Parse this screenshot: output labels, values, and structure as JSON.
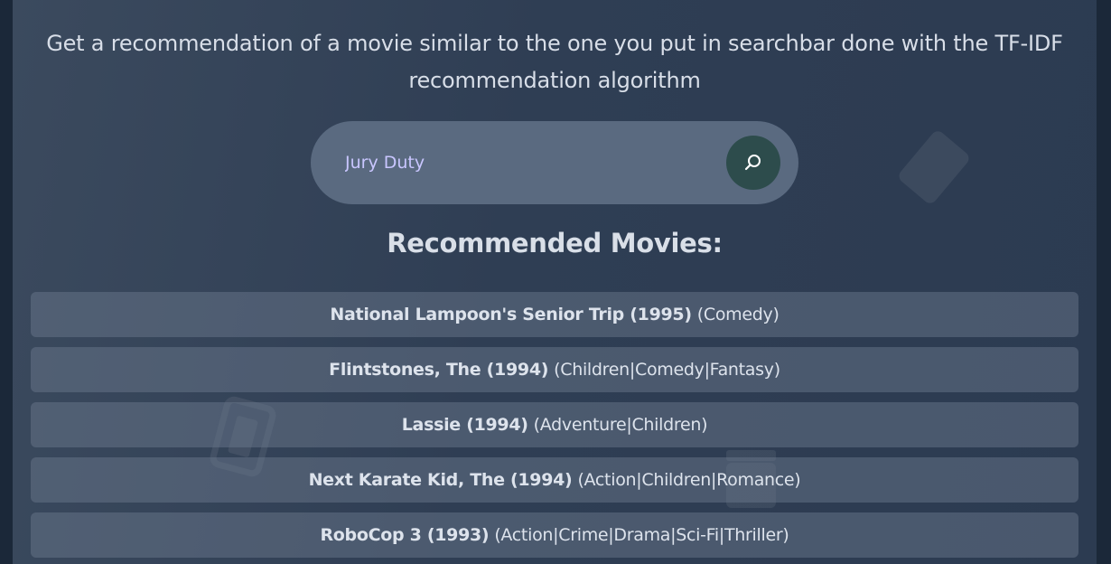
{
  "header": {
    "subtitle": "Get a recommendation of a movie similar to the one you put in searchbar done with the TF-IDF recommendation algorithm"
  },
  "search": {
    "value": "Jury Duty",
    "button_icon": "search-icon"
  },
  "results": {
    "heading": "Recommended Movies:",
    "movies": [
      {
        "title": "National Lampoon's Senior Trip (1995)",
        "genres": "(Comedy)"
      },
      {
        "title": "Flintstones, The (1994)",
        "genres": "(Children|Comedy|Fantasy)"
      },
      {
        "title": "Lassie (1994)",
        "genres": "(Adventure|Children)"
      },
      {
        "title": "Next Karate Kid, The (1994)",
        "genres": "(Action|Children|Romance)"
      },
      {
        "title": "RoboCop 3 (1993)",
        "genres": "(Action|Crime|Drama|Sci-Fi|Thriller)"
      }
    ]
  },
  "colors": {
    "page_background": "#1b2839",
    "panel_gradient_start": "#3b4a5e",
    "panel_gradient_end": "#2c3b51",
    "search_bar": "#5a6a80",
    "search_button": "#2d4c4c",
    "search_text": "#c9c6ff",
    "text": "#dde3ec"
  },
  "decorative_icons": [
    "ticket-icon",
    "ticket-icon",
    "film-clapper-icon"
  ]
}
